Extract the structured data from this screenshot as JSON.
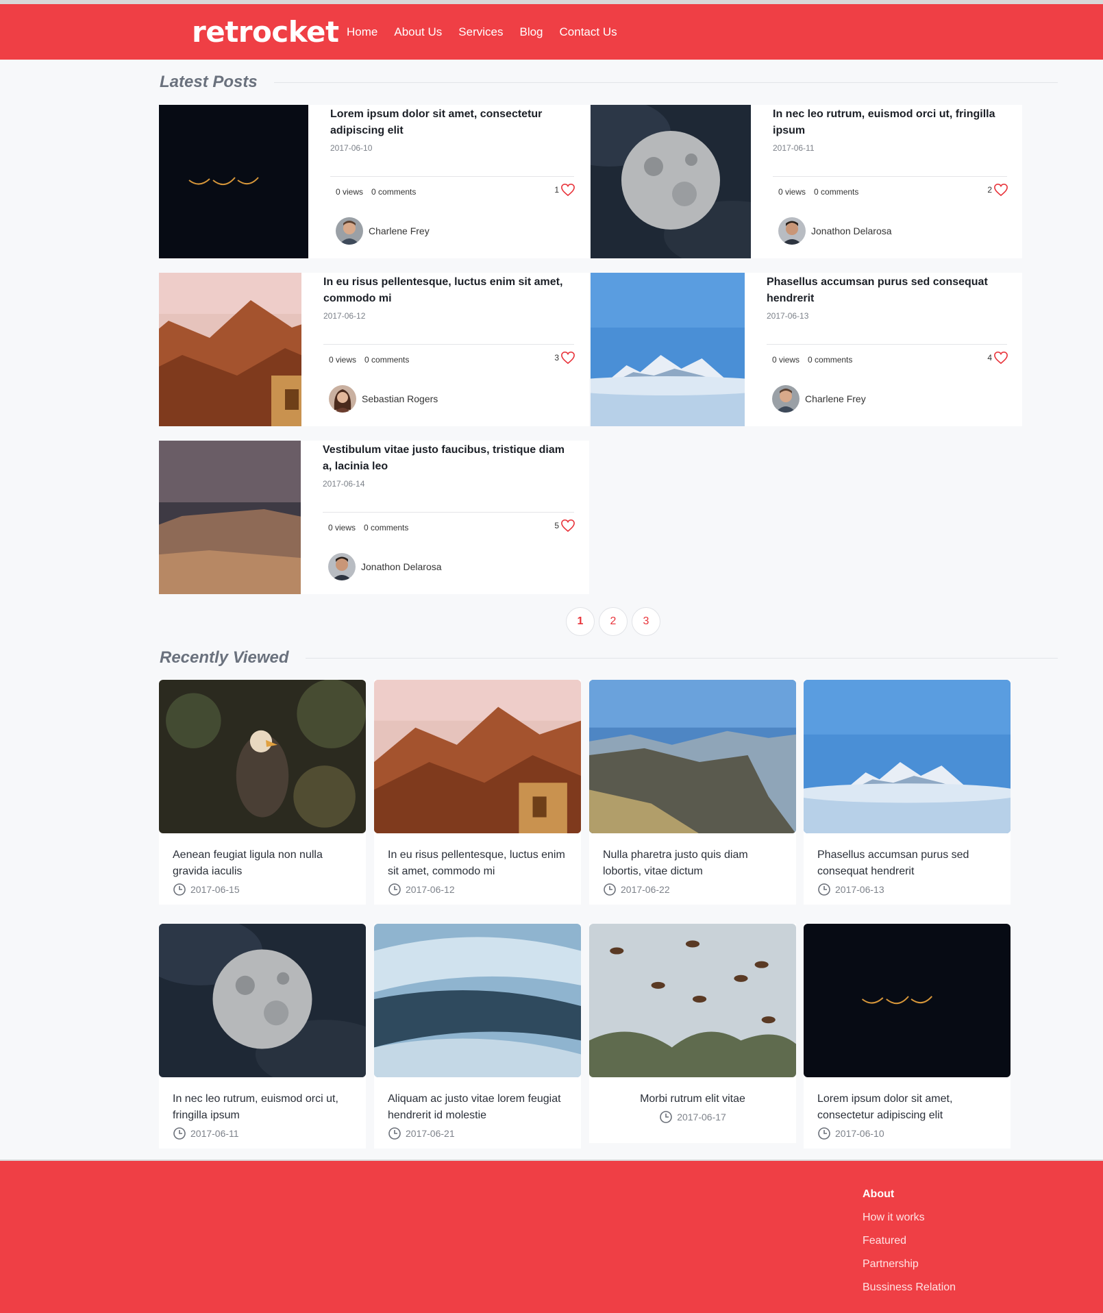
{
  "brand": {
    "logo": "retrocket",
    "accent": "#ef3f45"
  },
  "nav": [
    "Home",
    "About Us",
    "Services",
    "Blog",
    "Contact Us"
  ],
  "latest": {
    "title": "Latest Posts",
    "posts": [
      {
        "title": "Lorem ipsum dolor sit amet, consectetur adipiscing elit",
        "date": "2017-06-10",
        "views": "0 views",
        "comments": "0 comments",
        "likes": "1",
        "author": "Charlene Frey"
      },
      {
        "title": "In nec leo rutrum, euismod orci ut, fringilla ipsum",
        "date": "2017-06-11",
        "views": "0 views",
        "comments": "0 comments",
        "likes": "2",
        "author": "Jonathon Delarosa"
      },
      {
        "title": "In eu risus pellentesque, luctus enim sit amet, commodo mi",
        "date": "2017-06-12",
        "views": "0 views",
        "comments": "0 comments",
        "likes": "3",
        "author": "Sebastian Rogers"
      },
      {
        "title": "Phasellus accumsan purus sed consequat hendrerit",
        "date": "2017-06-13",
        "views": "0 views",
        "comments": "0 comments",
        "likes": "4",
        "author": "Charlene Frey"
      },
      {
        "title": "Vestibulum vitae justo faucibus, tristique diam a, lacinia leo",
        "date": "2017-06-14",
        "views": "0 views",
        "comments": "0 comments",
        "likes": "5",
        "author": "Jonathon Delarosa"
      }
    ]
  },
  "pagination": [
    "1",
    "2",
    "3"
  ],
  "recent": {
    "title": "Recently Viewed",
    "items": [
      {
        "title": "Aenean feugiat ligula non nulla gravida iaculis",
        "date": "2017-06-15"
      },
      {
        "title": "In eu risus pellentesque, luctus enim sit amet, commodo mi",
        "date": "2017-06-12"
      },
      {
        "title": "Nulla pharetra justo quis diam lobortis, vitae dictum",
        "date": "2017-06-22"
      },
      {
        "title": "Phasellus accumsan purus sed consequat hendrerit",
        "date": "2017-06-13"
      },
      {
        "title": "In nec leo rutrum, euismod orci ut, fringilla ipsum",
        "date": "2017-06-11"
      },
      {
        "title": "Aliquam ac justo vitae lorem feugiat hendrerit id molestie",
        "date": "2017-06-21"
      },
      {
        "title": "Morbi rutrum elit vitae",
        "date": "2017-06-17"
      },
      {
        "title": "Lorem ipsum dolor sit amet, consectetur adipiscing elit",
        "date": "2017-06-10"
      }
    ]
  },
  "footer": {
    "heading": "About",
    "links": [
      "How it works",
      "Featured",
      "Partnership",
      "Bussiness Relation"
    ]
  }
}
